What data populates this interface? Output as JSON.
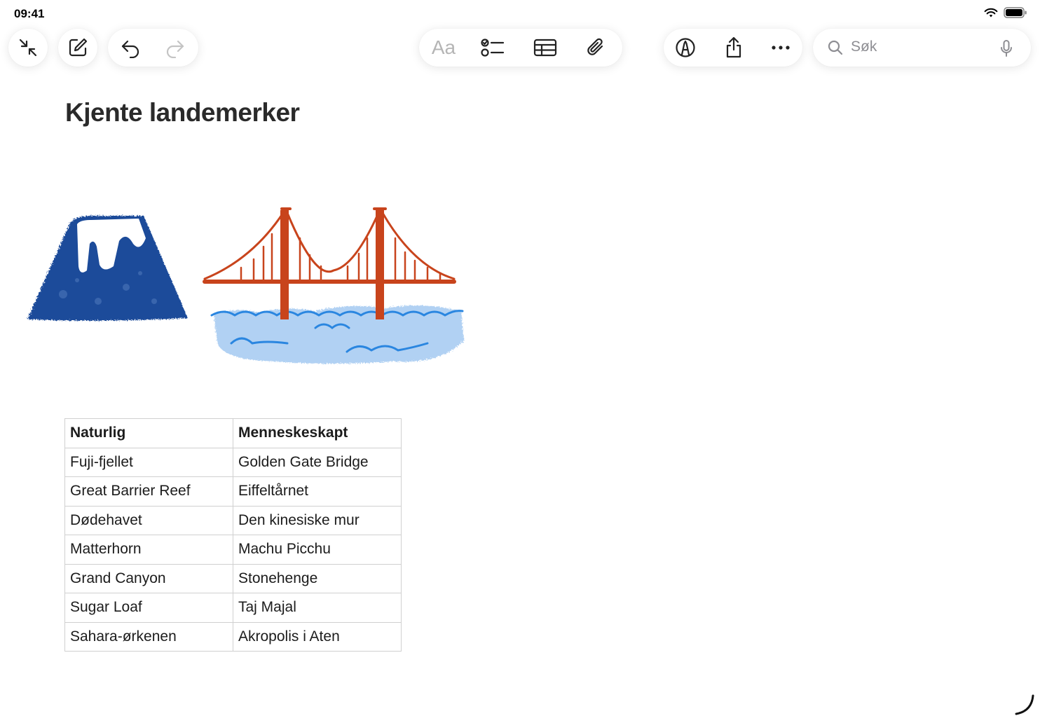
{
  "status_bar": {
    "time": "09:41"
  },
  "toolbar": {
    "format_label": "Aa"
  },
  "search": {
    "placeholder": "Søk"
  },
  "note": {
    "title": "Kjente landemerker",
    "table": {
      "header": [
        "Naturlig",
        "Menneskeskapt"
      ],
      "rows": [
        [
          "Fuji-fjellet",
          "Golden Gate Bridge"
        ],
        [
          "Great Barrier Reef",
          "Eiffeltårnet"
        ],
        [
          "Dødehavet",
          "Den kinesiske mur"
        ],
        [
          "Matterhorn",
          "Machu Picchu"
        ],
        [
          "Grand Canyon",
          "Stonehenge"
        ],
        [
          "Sugar Loaf",
          "Taj Majal"
        ],
        [
          "Sahara-ørkenen",
          "Akropolis i Aten"
        ]
      ]
    }
  },
  "colors": {
    "mountain": "#1c4b9a",
    "bridge": "#c8441c",
    "water": "#2a86e0"
  }
}
